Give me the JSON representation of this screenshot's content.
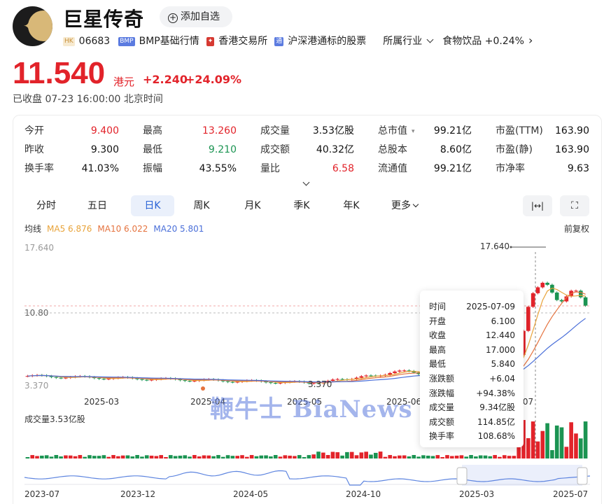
{
  "header": {
    "name": "巨星传奇",
    "watch_label": "添加自选",
    "watch_plus": "+",
    "market_tag": "HK",
    "code": "06683",
    "bmp_tag": "BMP",
    "bmp_label": "BMP基础行情",
    "hkex_tag": "✦",
    "hkex_label": "香港交易所",
    "connect_tag": "通",
    "connect_label": "沪深港通标的股票",
    "industry_label": "所属行业",
    "industry_value": "食物饮品 +0.24%",
    "chevron": "›"
  },
  "quote": {
    "price": "11.540",
    "currency": "港元",
    "change": "+2.240",
    "change_pct": "+24.09%",
    "status": "已收盘 07-23 16:00:00 北京时间"
  },
  "stats": [
    [
      {
        "label": "今开",
        "value": "9.400",
        "color": "red"
      },
      {
        "label": "最高",
        "value": "13.260",
        "color": "red"
      },
      {
        "label": "成交量",
        "value": "3.53亿股",
        "color": ""
      },
      {
        "label": "总市值",
        "value": "99.21亿",
        "color": ""
      },
      {
        "label": "市盈(TTM)",
        "value": "163.90",
        "color": ""
      }
    ],
    [
      {
        "label": "昨收",
        "value": "9.300",
        "color": ""
      },
      {
        "label": "最低",
        "value": "9.210",
        "color": "green"
      },
      {
        "label": "成交额",
        "value": "40.32亿",
        "color": ""
      },
      {
        "label": "总股本",
        "value": "8.60亿",
        "color": ""
      },
      {
        "label": "市盈(静)",
        "value": "163.90",
        "color": ""
      }
    ],
    [
      {
        "label": "换手率",
        "value": "41.03%",
        "color": ""
      },
      {
        "label": "振幅",
        "value": "43.55%",
        "color": ""
      },
      {
        "label": "量比",
        "value": "6.58",
        "color": "red"
      },
      {
        "label": "流通值",
        "value": "99.21亿",
        "color": ""
      },
      {
        "label": "市净率",
        "value": "9.63",
        "color": ""
      }
    ]
  ],
  "expand_icon": "⌄",
  "tabs": [
    "分时",
    "五日",
    "日K",
    "周K",
    "月K",
    "季K",
    "年K",
    "更多"
  ],
  "active_tab": "日K",
  "more_chevron": "⌄",
  "tool_icons": {
    "fit": "|↔|",
    "fullscreen": "⛶"
  },
  "ma": {
    "label": "均线",
    "ma5": "MA5 6.876",
    "ma10": "MA10 6.022",
    "ma20": "MA20 5.801",
    "colors": {
      "ma5": "#e8a33a",
      "ma10": "#e5733f",
      "ma20": "#4a6fd9"
    }
  },
  "adjust_label": "前复权",
  "chart": {
    "y_high_label": "17.640",
    "y_mid_label": "10.80",
    "y_low_label": "3.370",
    "max_marker": "17.640",
    "min_marker": "3.370",
    "x_labels": [
      "2025-03",
      "2025-04",
      "2025-05",
      "2025-06",
      "2025-07"
    ],
    "volume_label": "成交量3.53亿股",
    "nav_x_labels": [
      "2023-07",
      "2023-12",
      "2024-05",
      "2024-10",
      "2025-03",
      "2025-07"
    ]
  },
  "tooltip": [
    {
      "label": "时间",
      "value": "2025-07-09",
      "color": ""
    },
    {
      "label": "开盘",
      "value": "6.100",
      "color": "green"
    },
    {
      "label": "收盘",
      "value": "12.440",
      "color": "red"
    },
    {
      "label": "最高",
      "value": "17.000",
      "color": "red"
    },
    {
      "label": "最低",
      "value": "5.840",
      "color": "green"
    },
    {
      "label": "涨跌额",
      "value": "+6.04",
      "color": "red"
    },
    {
      "label": "涨跌幅",
      "value": "+94.38%",
      "color": "red"
    },
    {
      "label": "成交量",
      "value": "9.34亿股",
      "color": ""
    },
    {
      "label": "成交额",
      "value": "114.85亿",
      "color": ""
    },
    {
      "label": "换手率",
      "value": "108.68%",
      "color": ""
    }
  ],
  "watermark": "鞭牛士 BiaNews",
  "colors": {
    "up": "#e2232a",
    "down": "#1b9452",
    "accent": "#2962d6"
  }
}
